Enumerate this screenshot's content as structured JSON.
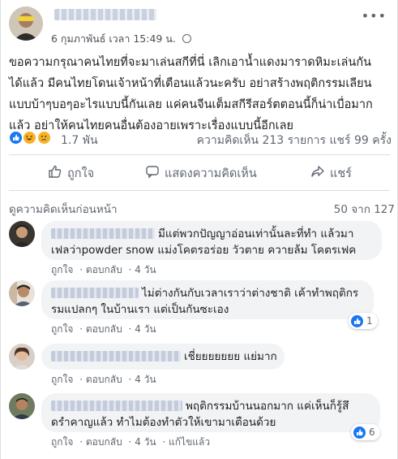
{
  "post": {
    "time": "6 กุมภาพันธ์ เวลา 15:49 น.",
    "more_label": "•••",
    "text_lines": [
      "ขอความกรุณาคนไทยที่จะมาเล่นสกีที่นี่ เลิกเอาน้ำแดงมาราดหิมะเล่นกัน",
      "ได้แล้ว มีคนไทยโดนเจ้าหน้าที่เตือนแล้วนะครับ อย่าสร้างพฤติกรรมเลียน",
      "แบบบ้าๆบอๆอะไรแบบนี้กันเลย แค่คนจีนเต็มสกีรีสอร์ตตอนนี้ก็น่าเบื่อมาก",
      "แล้ว อย่าให้คนไทยคนอื่นต้องอายเพราะเรื่องแบบนี้อีกเลย"
    ],
    "reaction_count": "1.7 พัน",
    "stats": "ความคิดเห็น 213 รายการ  แชร์ 99 ครั้ง",
    "actions": {
      "like": "ถูกใจ",
      "comment": "แสดงความคิดเห็น",
      "share": "แชร์"
    }
  },
  "comments_header": {
    "previous": "ดูความคิดเห็นก่อนหน้า",
    "count": "50 จาก 127"
  },
  "comments": [
    {
      "lines": [
        "มีแต่พวกปัญญาอ่อนเท่านั้นละที่ทำ แล้วมา",
        "เฟลว่าpowder snow แม่งโคตรอร่อย วัวตาย ควายล้ม โคตรเฟค"
      ],
      "like": "ถูกใจ",
      "reply": "ตอบกลับ",
      "time": "4 วัน",
      "likes": ""
    },
    {
      "lines": [
        "ไม่ต่างกันกับเวลาเราว่าต่างชาติ เค้าทำพฤติกร",
        "รมแปลกๆ ในบ้านเรา แต่เป็นกันซะเอง"
      ],
      "like": "ถูกใจ",
      "reply": "ตอบกลับ",
      "time": "4 วัน",
      "likes": "1"
    },
    {
      "lines": [
        "เชี่ยยยยยยย แย่มาก"
      ],
      "like": "ถูกใจ",
      "reply": "ตอบกลับ",
      "time": "4 วัน",
      "likes": ""
    },
    {
      "lines": [
        "พฤติกรรมบ้านนอกมาก แค่เห็นก็รู้สึ",
        "ดรำคาญแล้ว ทำไมต้องทำตัวให้เขามาเตือนด้วย"
      ],
      "like": "ถูกใจ",
      "reply": "ตอบกลับ",
      "time": "4 วัน",
      "edited": "แก้ไขแล้ว",
      "likes": "6"
    }
  ],
  "colors": {
    "brand_blue": "#1877f2",
    "bubble_bg": "#f2f3f5",
    "meta_text": "#606770"
  }
}
